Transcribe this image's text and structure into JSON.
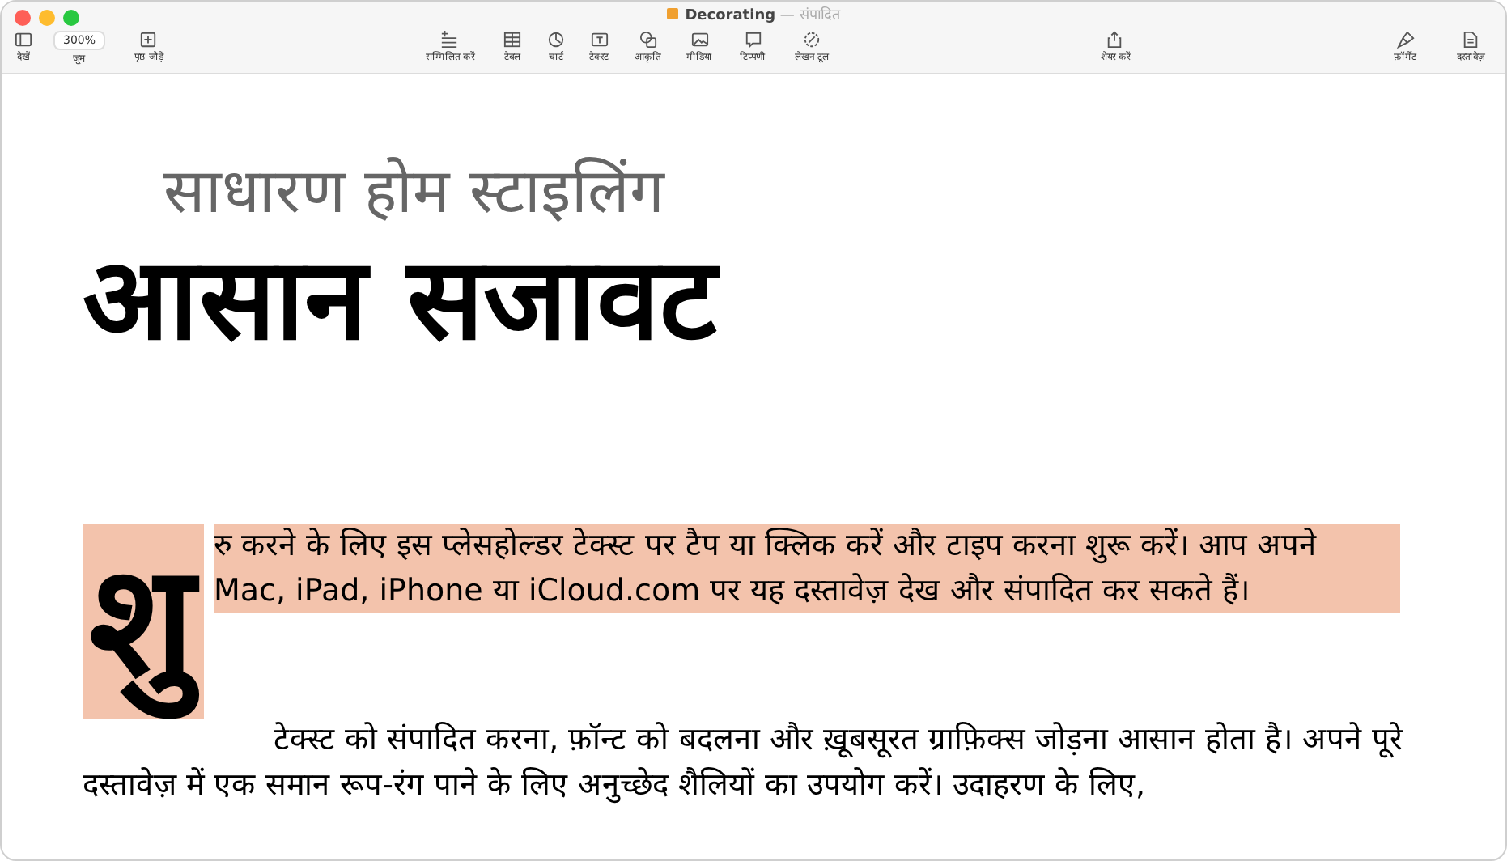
{
  "window": {
    "title": "Decorating",
    "status": "— संपादित"
  },
  "toolbar": [
    {
      "kind": "sidebar",
      "label": "देखें"
    },
    {
      "kind": "zoom",
      "label": "ज़ूम",
      "value": "300%"
    },
    {
      "kind": "addpage",
      "label": "पृष्ठ जोड़ें"
    },
    {
      "kind": "insert",
      "label": "सम्मिलित करें"
    },
    {
      "kind": "table",
      "label": "टेबल"
    },
    {
      "kind": "chart",
      "label": "चार्ट"
    },
    {
      "kind": "text",
      "label": "टेक्स्ट"
    },
    {
      "kind": "shape",
      "label": "आकृति"
    },
    {
      "kind": "media",
      "label": "मीडिया"
    },
    {
      "kind": "comment",
      "label": "टिप्पणी"
    },
    {
      "kind": "writing",
      "label": "लेखन टूल"
    },
    {
      "kind": "share",
      "label": "शेयर करें"
    },
    {
      "kind": "format",
      "label": "फ़ॉर्मैट"
    },
    {
      "kind": "document",
      "label": "दस्तावेज़"
    }
  ],
  "document": {
    "subtitle": "साधारण होम स्टाइलिंग",
    "title": "आसान सजावट",
    "paragraphs": [
      {
        "drop_cap": "शु",
        "text": "रु करने के लिए इस प्लेसहोल्डर टेक्स्ट पर टैप या क्लिक करें और टाइप करना शुरू करें। आप अपने Mac, iPad, iPhone या iCloud.com पर यह दस्तावेज़ देख और संपादित कर सकते हैं।",
        "selected": true
      },
      {
        "text": "टेक्स्ट को संपादित करना, फ़ॉन्ट को बदलना और ख़ूबसूरत ग्राफ़िक्स जोड़ना आसान होता है। अपने पूरे दस्तावेज़ में एक समान रूप-रंग पाने के लिए अनुच्छेद शैलियों का उपयोग करें। उदाहरण के लिए,",
        "selected": false
      }
    ]
  }
}
